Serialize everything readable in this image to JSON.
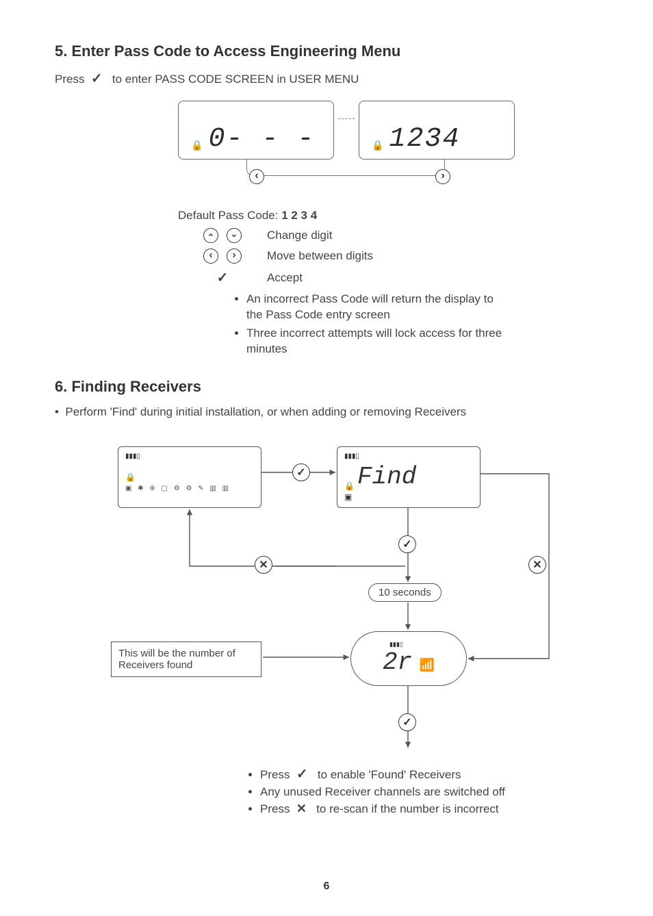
{
  "section5": {
    "heading": "5. Enter Pass Code to Access Engineering Menu",
    "press_prefix": "Press",
    "press_suffix": "to enter PASS CODE SCREEN in USER MENU",
    "lcd_left": "0- - -",
    "lcd_right": "1234",
    "default_label": "Default Pass Code:",
    "default_value": "1  2  3  4",
    "legend": {
      "change_digit": "Change digit",
      "move_digits": "Move between digits",
      "accept": "Accept"
    },
    "notes": [
      "An incorrect Pass Code will return the display to the Pass Code entry screen",
      "Three incorrect attempts will lock access for three minutes"
    ]
  },
  "section6": {
    "heading": "6. Finding Receivers",
    "intro": "Perform 'Find' during initial installation, or when adding or removing Receivers",
    "find_label": "Find",
    "result_label": "2r",
    "ten_seconds": "10 seconds",
    "note_box": "This will be the number of Receivers found",
    "bullets": {
      "b1_pre": "Press",
      "b1_post": "to enable 'Found' Receivers",
      "b2": "Any unused Receiver channels are switched off",
      "b3_pre": "Press",
      "b3_post": "to re-scan if the number is incorrect"
    }
  },
  "page_number": "6"
}
